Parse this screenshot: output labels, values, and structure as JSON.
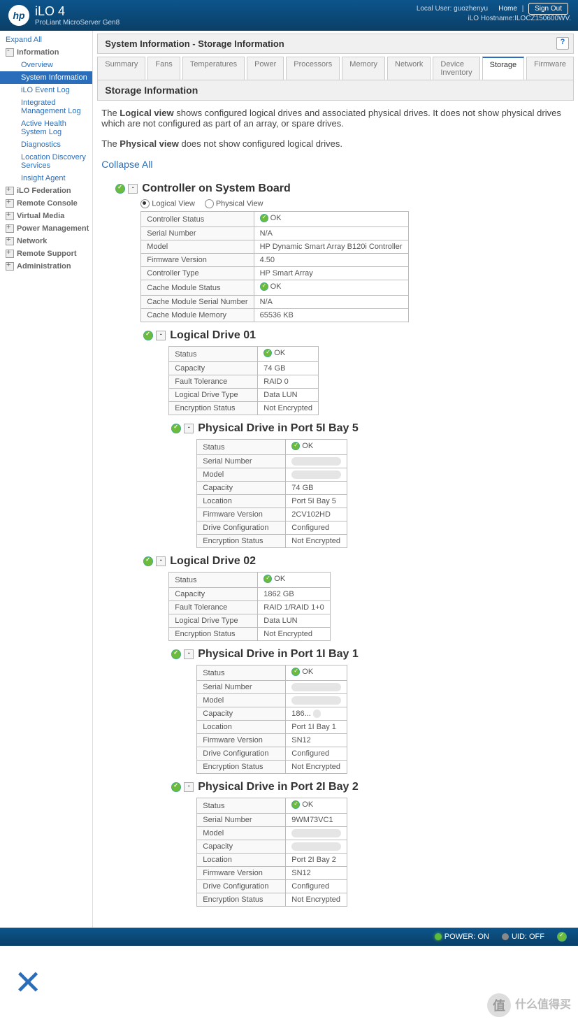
{
  "header": {
    "product": "iLO 4",
    "model": "ProLiant MicroServer Gen8",
    "local_user_label": "Local User:",
    "local_user": "guozhenyu",
    "hostname_label": "iLO Hostname:ILOCZ150600WV.",
    "home": "Home",
    "signout": "Sign Out"
  },
  "sidebar": {
    "expand_all": "Expand All",
    "groups": [
      {
        "label": "Information",
        "open": true,
        "items": [
          {
            "label": "Overview"
          },
          {
            "label": "System Information",
            "active": true
          },
          {
            "label": "iLO Event Log"
          },
          {
            "label": "Integrated Management Log"
          },
          {
            "label": "Active Health System Log"
          },
          {
            "label": "Diagnostics"
          },
          {
            "label": "Location Discovery Services"
          },
          {
            "label": "Insight Agent"
          }
        ]
      },
      {
        "label": "iLO Federation"
      },
      {
        "label": "Remote Console"
      },
      {
        "label": "Virtual Media"
      },
      {
        "label": "Power Management"
      },
      {
        "label": "Network"
      },
      {
        "label": "Remote Support"
      },
      {
        "label": "Administration"
      }
    ]
  },
  "page": {
    "title": "System Information - Storage Information",
    "tabs": [
      "Summary",
      "Fans",
      "Temperatures",
      "Power",
      "Processors",
      "Memory",
      "Network",
      "Device Inventory",
      "Storage",
      "Firmware"
    ],
    "active_tab": 8,
    "section": "Storage Information",
    "desc1a": "The ",
    "desc1b": "Logical view",
    "desc1c": " shows configured logical drives and associated physical drives. It does not show physical drives which are not configured as part of an array, or spare drives.",
    "desc2a": "The ",
    "desc2b": "Physical view",
    "desc2c": " does not show configured logical drives.",
    "collapse_all": "Collapse All"
  },
  "controller": {
    "title": "Controller on System Board",
    "view_logical": "Logical View",
    "view_physical": "Physical View",
    "rows": [
      [
        "Controller Status",
        "OK",
        true
      ],
      [
        "Serial Number",
        "N/A",
        false
      ],
      [
        "Model",
        "HP Dynamic Smart Array B120i Controller",
        false
      ],
      [
        "Firmware Version",
        "4.50",
        false
      ],
      [
        "Controller Type",
        "HP Smart Array",
        false
      ],
      [
        "Cache Module Status",
        "OK",
        true
      ],
      [
        "Cache Module Serial Number",
        "N/A",
        false
      ],
      [
        "Cache Module Memory",
        "65536 KB",
        false
      ]
    ]
  },
  "ld01": {
    "title": "Logical Drive 01",
    "rows": [
      [
        "Status",
        "OK",
        true
      ],
      [
        "Capacity",
        "74 GB",
        false
      ],
      [
        "Fault Tolerance",
        "RAID 0",
        false
      ],
      [
        "Logical Drive Type",
        "Data LUN",
        false
      ],
      [
        "Encryption Status",
        "Not Encrypted",
        false
      ]
    ]
  },
  "pd5": {
    "title": "Physical Drive in Port 5I Bay 5",
    "rows": [
      [
        "Status",
        "OK",
        true
      ],
      [
        "Serial Number",
        "",
        false,
        "blur"
      ],
      [
        "Model",
        "",
        false,
        "blur"
      ],
      [
        "Capacity",
        "74 GB",
        false
      ],
      [
        "Location",
        "Port 5I Bay 5",
        false
      ],
      [
        "Firmware Version",
        "2CV102HD",
        false
      ],
      [
        "Drive Configuration",
        "Configured",
        false
      ],
      [
        "Encryption Status",
        "Not Encrypted",
        false
      ]
    ]
  },
  "ld02": {
    "title": "Logical Drive 02",
    "rows": [
      [
        "Status",
        "OK",
        true
      ],
      [
        "Capacity",
        "1862 GB",
        false
      ],
      [
        "Fault Tolerance",
        "RAID 1/RAID 1+0",
        false
      ],
      [
        "Logical Drive Type",
        "Data LUN",
        false
      ],
      [
        "Encryption Status",
        "Not Encrypted",
        false
      ]
    ]
  },
  "pd1": {
    "title": "Physical Drive in Port 1I Bay 1",
    "rows": [
      [
        "Status",
        "OK",
        true
      ],
      [
        "Serial Number",
        "",
        false,
        "blur"
      ],
      [
        "Model",
        "",
        false,
        "blur"
      ],
      [
        "Capacity",
        "186...",
        false,
        "blurpart"
      ],
      [
        "Location",
        "Port 1I Bay 1",
        false
      ],
      [
        "Firmware Version",
        "SN12",
        false
      ],
      [
        "Drive Configuration",
        "Configured",
        false
      ],
      [
        "Encryption Status",
        "Not Encrypted",
        false
      ]
    ]
  },
  "pd2": {
    "title": "Physical Drive in Port 2I Bay 2",
    "rows": [
      [
        "Status",
        "OK",
        true
      ],
      [
        "Serial Number",
        "9WM73VC1",
        false
      ],
      [
        "Model",
        "",
        false,
        "blur"
      ],
      [
        "Capacity",
        "",
        false,
        "blur"
      ],
      [
        "Location",
        "Port 2I Bay 2",
        false
      ],
      [
        "Firmware Version",
        "SN12",
        false
      ],
      [
        "Drive Configuration",
        "Configured",
        false
      ],
      [
        "Encryption Status",
        "Not Encrypted",
        false
      ]
    ]
  },
  "footer": {
    "power": "POWER: ON",
    "uid": "UID: OFF"
  },
  "watermark": "什么值得买"
}
